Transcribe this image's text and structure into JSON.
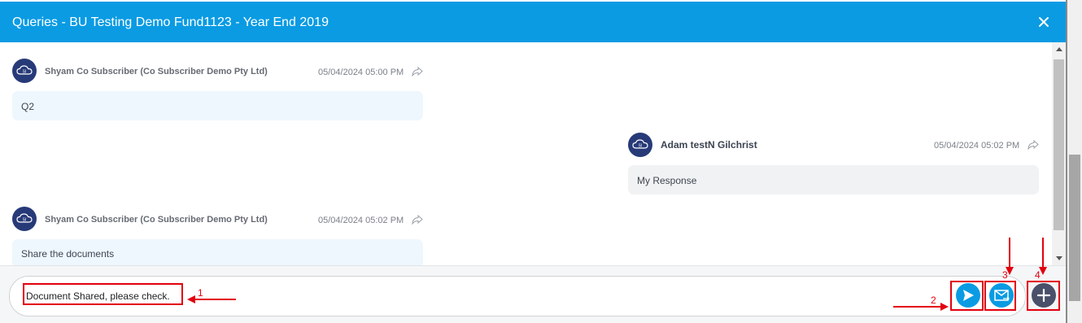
{
  "modal": {
    "title": "Queries - BU Testing Demo Fund1123 - Year End 2019"
  },
  "messages": [
    {
      "sender": "Shyam Co Subscriber (Co Subscriber Demo Pty Ltd)",
      "time": "05/04/2024 05:00 PM",
      "text": "Q2"
    },
    {
      "sender": "Adam testN Gilchrist",
      "time": "05/04/2024 05:02 PM",
      "text": "My Response"
    },
    {
      "sender": "Shyam Co Subscriber (Co Subscriber Demo Pty Ltd)",
      "time": "05/04/2024 05:02 PM",
      "text": "Share the documents"
    }
  ],
  "composer": {
    "value": "Document Shared, please check."
  },
  "annotations": [
    "1",
    "2",
    "3",
    "4"
  ],
  "icons": {
    "close": "close-icon",
    "avatar": "cloud-avatar-icon",
    "share": "share-icon",
    "send": "send-icon",
    "email": "email-send-icon",
    "add": "plus-icon"
  },
  "colors": {
    "header": "#0a9be3",
    "avatar": "#273a78",
    "send_button": "#0a9be3",
    "add_button": "#4a5069",
    "annotation": "#e3000f",
    "bubble_incoming": "#eef7fe",
    "bubble_outgoing": "#f1f2f4"
  }
}
